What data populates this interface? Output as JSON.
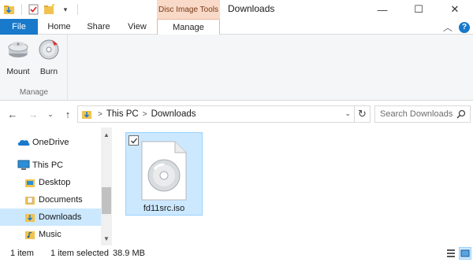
{
  "window": {
    "title": "Downloads",
    "context_tab_group": "Disc Image Tools",
    "controls": {
      "minimize": "—",
      "maximize": "☐",
      "close": "✕"
    }
  },
  "quick_access": {
    "dropdown_glyph": "▾"
  },
  "ribbon_tabs": {
    "file": "File",
    "home": "Home",
    "share": "Share",
    "view": "View",
    "manage": "Manage",
    "collapse_glyph": "︿",
    "help_glyph": "?"
  },
  "ribbon": {
    "mount": "Mount",
    "burn": "Burn",
    "group_label": "Manage"
  },
  "address": {
    "path": [
      "This PC",
      "Downloads"
    ],
    "separator": ">",
    "dropdown_glyph": "⌄",
    "refresh_glyph": "↻",
    "search_placeholder": "Search Downloads"
  },
  "nav_glyphs": {
    "back": "←",
    "forward": "→",
    "recent": "⌄",
    "up": "↑"
  },
  "navigation_pane": {
    "items": [
      {
        "label": "OneDrive",
        "icon": "onedrive-icon"
      },
      {
        "label": "This PC",
        "icon": "this-pc-icon"
      },
      {
        "label": "Desktop",
        "icon": "desktop-folder-icon"
      },
      {
        "label": "Documents",
        "icon": "documents-folder-icon"
      },
      {
        "label": "Downloads",
        "icon": "downloads-folder-icon",
        "selected": true
      },
      {
        "label": "Music",
        "icon": "music-folder-icon"
      }
    ],
    "scroll_up": "▲",
    "scroll_down": "▼"
  },
  "files": [
    {
      "name": "fd11src.iso",
      "icon": "disc-image-icon",
      "selected": true,
      "checked": true
    }
  ],
  "status": {
    "item_count": "1 item",
    "selected": "1 item selected",
    "size": "38.9 MB"
  },
  "colors": {
    "accent": "#1979ca",
    "context_tab": "#f9d9c7",
    "selection": "#cce8ff",
    "selection_border": "#99d1ff"
  }
}
